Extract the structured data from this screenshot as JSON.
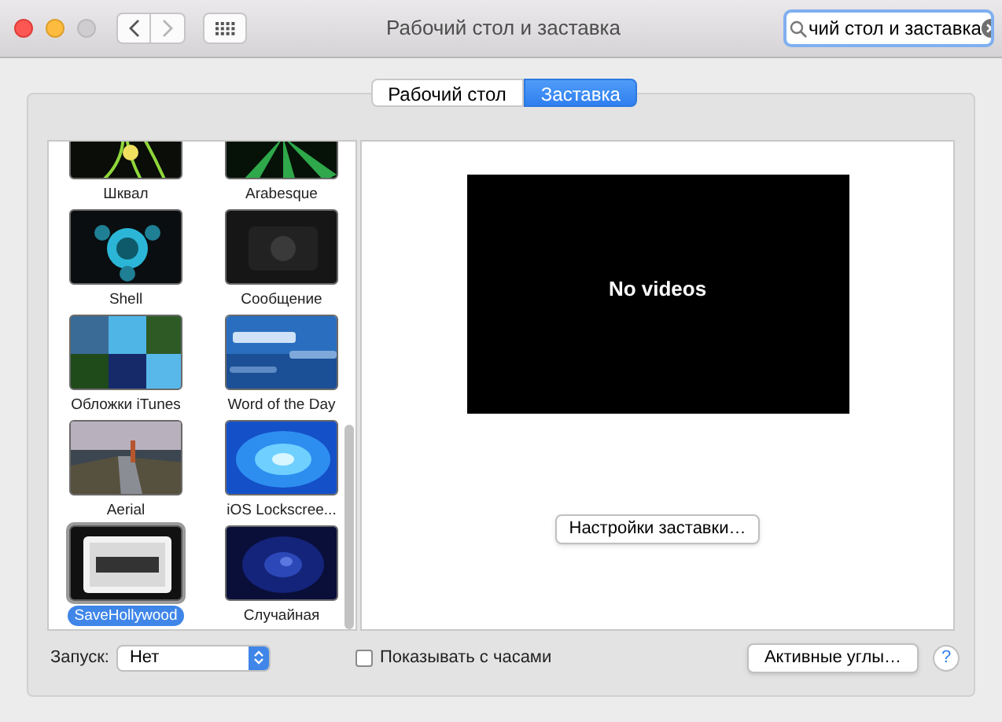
{
  "window": {
    "title": "Рабочий стол и заставка",
    "controls": [
      {
        "kind": "close"
      },
      {
        "kind": "minimize"
      },
      {
        "kind": "zoom",
        "disabled": true
      }
    ],
    "nav": [
      {
        "kind": "back",
        "disabled": false
      },
      {
        "kind": "forward",
        "disabled": true
      }
    ],
    "search": {
      "value": "чий стол и заставка"
    }
  },
  "tabs": [
    {
      "label": "Рабочий стол",
      "selected": false
    },
    {
      "label": "Заставка",
      "selected": true
    }
  ],
  "screensavers": [
    {
      "label": "Шквал",
      "selected": false,
      "kind": "picture"
    },
    {
      "label": "Arabesque",
      "selected": false,
      "kind": "picture"
    },
    {
      "label": "Shell",
      "selected": false,
      "kind": "picture"
    },
    {
      "label": "Сообщение",
      "selected": false,
      "kind": "picture"
    },
    {
      "label": "Обложки iTunes",
      "selected": false,
      "kind": "picture"
    },
    {
      "label": "Word of the Day",
      "selected": false,
      "kind": "picture"
    },
    {
      "label": "Aerial",
      "selected": false,
      "kind": "picture"
    },
    {
      "label": "iOS Lockscree...",
      "selected": false,
      "kind": "picture"
    },
    {
      "label": "SaveHollywood",
      "selected": true,
      "kind": "picture"
    },
    {
      "label": "Случайная",
      "selected": false,
      "kind": "picture"
    }
  ],
  "preview": {
    "message": "No videos",
    "options_button": "Настройки заставки…"
  },
  "bottom": {
    "start_label": "Запуск:",
    "start_value": "Нет",
    "show_clock": {
      "label": "Показывать с часами",
      "checked": false
    },
    "hot_corners_button": "Активные углы…",
    "help": "?"
  }
}
